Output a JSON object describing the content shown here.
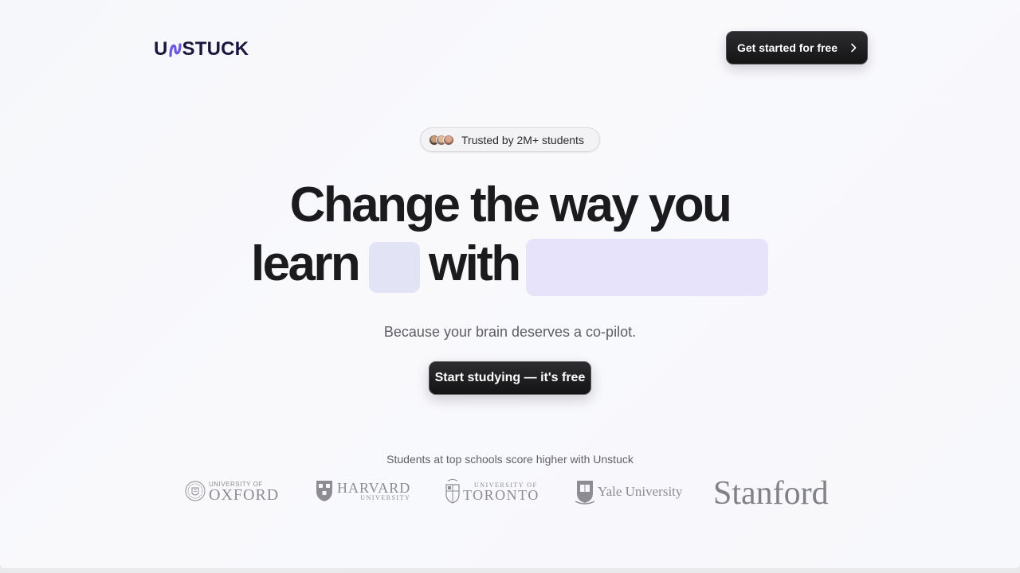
{
  "header": {
    "logo_text_left": "U",
    "logo_text_right": "STUCK",
    "cta_label": "Get started for free",
    "cta_icon": "chevron-right-icon"
  },
  "hero": {
    "badge_text": "Trusted by 2M+ students",
    "headline_line1": "Change the way you",
    "headline_word_learn": "learn",
    "headline_word_with": "with",
    "subheadline": "Because your brain deserves a co-pilot.",
    "cta_label": "Start studying — it's free"
  },
  "schools": {
    "caption": "Students at top schools score higher with Unstuck",
    "logos": [
      {
        "small": "UNIVERSITY OF",
        "big": "OXFORD"
      },
      {
        "big": "HARVARD",
        "small": "UNIVERSITY"
      },
      {
        "small": "UNIVERSITY OF",
        "big": "TORONTO"
      },
      {
        "big": "Yale University"
      },
      {
        "big": "Stanford"
      }
    ]
  },
  "colors": {
    "accent": "#6e57e0",
    "logo_text": "#1a1640",
    "button_bg": "#1a1a1c",
    "placeholder_small": "#e3e3f6",
    "placeholder_big": "#e6e3fb"
  }
}
